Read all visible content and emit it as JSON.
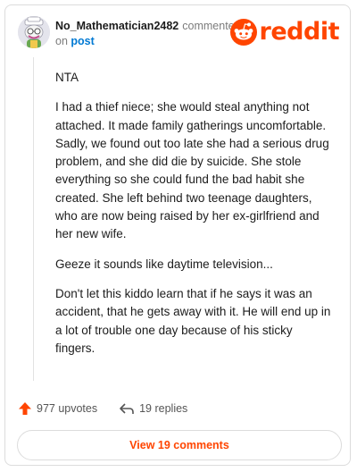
{
  "comment": {
    "author": "No_Mathematician2482",
    "action": "commented",
    "on_prefix": "on",
    "post_link": "post",
    "paragraphs": [
      "NTA",
      "I had a thief niece; she would steal anything not attached. It made family gatherings uncomfortable. Sadly, we found out too late she had a serious drug problem, and she did die by suicide. She stole everything so she could fund the bad habit she created. She left behind two teenage daughters, who are now being raised by her ex-girlfriend and her new wife.",
      "Geeze it sounds like daytime television...",
      "Don't let this kiddo learn that if he says it was an accident, that he gets away with it. He will end up in a lot of trouble one day because of his sticky fingers."
    ]
  },
  "brand": {
    "wordmark": "reddit",
    "color": "#ff4500"
  },
  "footer": {
    "upvotes": "977 upvotes",
    "replies": "19 replies"
  },
  "view_button": {
    "label": "View 19 comments"
  },
  "colors": {
    "accent": "#ff4500",
    "link": "#0079d3",
    "muted": "#7c7c7c",
    "border": "#dcdcdc"
  },
  "icons": {
    "avatar": "snoo-avatar-icon",
    "logo": "reddit-snoo-icon",
    "upvote": "upvote-arrow-icon",
    "reply": "reply-arrow-icon"
  }
}
